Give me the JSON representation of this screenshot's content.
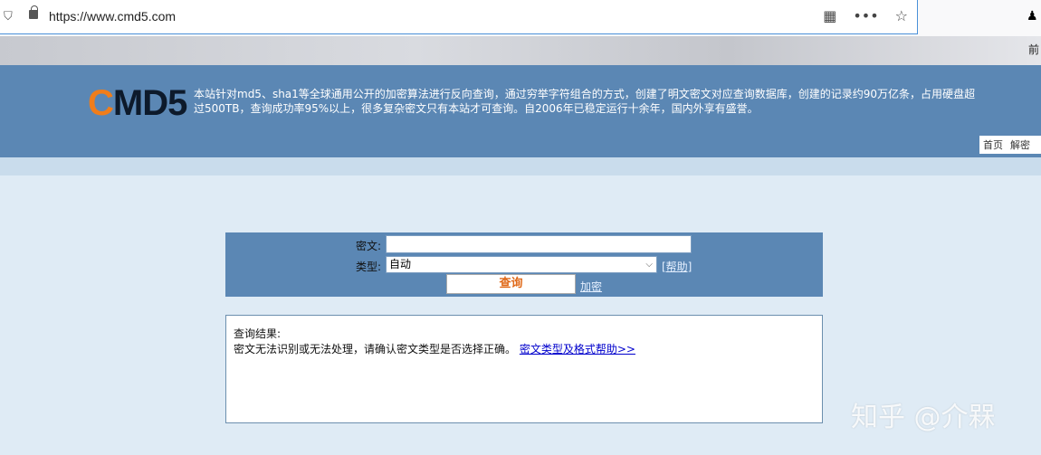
{
  "browser": {
    "url": "https://www.cmd5.com",
    "bookmark_partial": "前"
  },
  "header": {
    "logo": "CMD5",
    "logo_c": "C",
    "logo_rest": "MD5",
    "description": "本站针对md5、sha1等全球通用公开的加密算法进行反向查询，通过穷举字符组合的方式，创建了明文密文对应查询数据库，创建的记录约90万亿条，占用硬盘超过500TB，查询成功率95%以上，很多复杂密文只有本站才可查询。自2006年已稳定运行十余年，国内外享有盛誉。",
    "nav": [
      "首页",
      "解密"
    ]
  },
  "form": {
    "cipher_label": "密文:",
    "cipher_value": "",
    "type_label": "类型:",
    "type_value": "自动",
    "help_link": "[帮助]",
    "query_button": "查询",
    "encrypt_link": "加密"
  },
  "result": {
    "title": "查询结果:",
    "message": "密文无法识别或无法处理，请确认密文类型是否选择正确。",
    "help_link": "密文类型及格式帮助>>"
  },
  "watermark": "知乎 @介槑"
}
